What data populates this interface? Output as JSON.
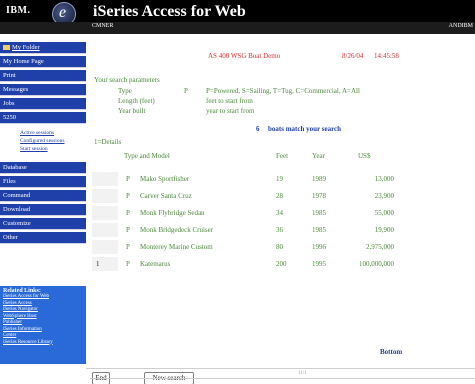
{
  "header": {
    "logo": "IBM.",
    "e_glyph": "e",
    "title": "iSeries Access for Web",
    "system": "CMNER",
    "user": "ANDIBM"
  },
  "sidebar": {
    "my_folder": "My Folder",
    "items": [
      "My Home Page",
      "Print",
      "Messages",
      "Jobs",
      "5250",
      "Database",
      "Files",
      "Command",
      "Download",
      "Customize",
      "Other"
    ],
    "sub_5250": [
      "Active sessions",
      "Configured sessions",
      "Start session"
    ],
    "related_title": "Related Links:",
    "related_links": [
      "iSeries Access for Web",
      "iSeries Access",
      "iSeries Navigator",
      "WebSphere Host",
      "Publisher",
      "iSeries Information",
      "Center",
      "iSeries Resource Library"
    ]
  },
  "screen": {
    "demo_title": "AS 400 WSG Boat Demo",
    "date": "8/26/04",
    "time": "14:45:58",
    "params_label": "Your search parameters",
    "type_label": "Type",
    "type_value": "P",
    "type_legend": "P=Powered, S=Sailing, T=Tug, C=Commercial, A=All",
    "length_label": "Length (feet)",
    "length_value": "feet to start from",
    "year_label": "Year built",
    "year_value": "year to start from",
    "match_count": "6",
    "match_text": "boats match your search",
    "details_hint": "1=Details",
    "col_type_model": "Type and Model",
    "col_feet": "Feet",
    "col_year": "Year",
    "col_us": "US$",
    "rows": [
      {
        "opt": "",
        "type": "P",
        "model": "Mako Sportfisher",
        "feet": "19",
        "year": "1989",
        "price": "13,000"
      },
      {
        "opt": "",
        "type": "P",
        "model": "Carver Santa Cruz",
        "feet": "28",
        "year": "1978",
        "price": "23,900"
      },
      {
        "opt": "",
        "type": "P",
        "model": "Monk Flybridge Sedan",
        "feet": "34",
        "year": "1985",
        "price": "55,000"
      },
      {
        "opt": "",
        "type": "P",
        "model": "Monk Bridgedeck Cruiser",
        "feet": "36",
        "year": "1985",
        "price": "19,900"
      },
      {
        "opt": "",
        "type": "P",
        "model": "Monterey Marine Custom",
        "feet": "80",
        "year": "1996",
        "price": "2,975,000"
      },
      {
        "opt": "1",
        "type": "P",
        "model": "Katemarus",
        "feet": "200",
        "year": "1995",
        "price": "100,000,000"
      }
    ],
    "bottom": "Bottom",
    "end_button": "End",
    "new_search_button": "New search",
    "status_left": "1a",
    "status_right": "11/1"
  }
}
